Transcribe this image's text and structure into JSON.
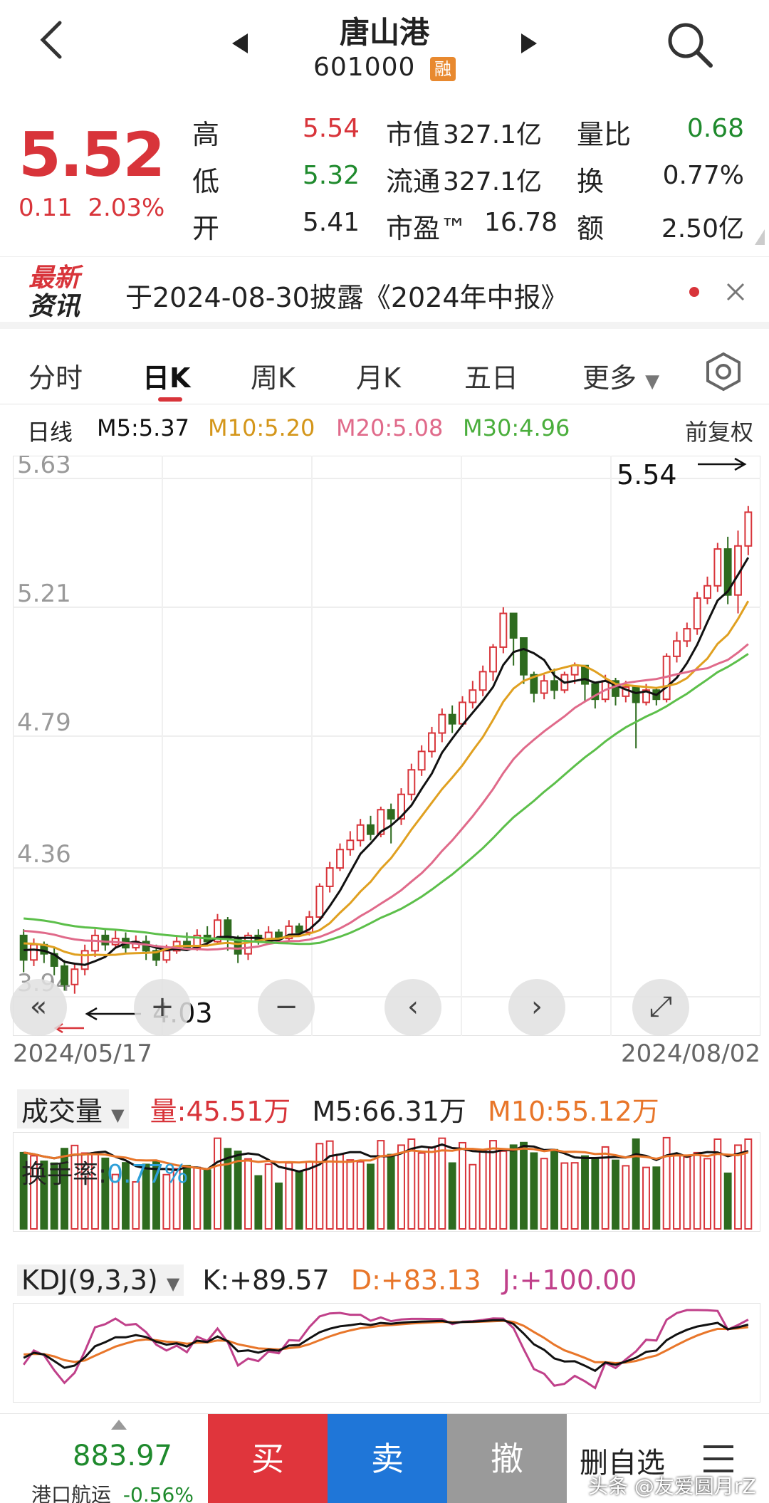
{
  "header": {
    "title": "唐山港",
    "code": "601000",
    "badge": "融"
  },
  "quote": {
    "price": "5.52",
    "change": "0.11",
    "change_pct": "2.03%",
    "high_label": "高",
    "high": "5.54",
    "low_label": "低",
    "low": "5.32",
    "open_label": "开",
    "open": "5.41",
    "mktcap_label": "市值",
    "mktcap": "327.1亿",
    "float_label": "流通",
    "float": "327.1亿",
    "pe_label": "市盈™",
    "pe": "16.78",
    "volratio_label": "量比",
    "volratio": "0.68",
    "turnover_label": "换",
    "turnover": "0.77%",
    "amount_label": "额",
    "amount": "2.50亿"
  },
  "news": {
    "logo_top": "最新",
    "logo_bottom": "资讯",
    "text": "于2024-08-30披露《2024年中报》"
  },
  "tabs": [
    {
      "label": "分时"
    },
    {
      "label": "日K"
    },
    {
      "label": "周K"
    },
    {
      "label": "月K"
    },
    {
      "label": "五日"
    },
    {
      "label": "更多"
    }
  ],
  "ma": {
    "period": "日线",
    "m5": "M5:5.37",
    "m10": "M10:5.20",
    "m20": "M20:5.08",
    "m30": "M30:4.96",
    "adjust": "前复权"
  },
  "colors": {
    "up": "#d8343a",
    "down": "#2e6b1f",
    "m5": "#111111",
    "m10": "#e0a020",
    "m20": "#e06a8a",
    "m30": "#5cbf4a",
    "k": "#111111",
    "d": "#e8762a",
    "j": "#c0408a"
  },
  "chart_data": {
    "type": "candlestick",
    "y_ticks": [
      "5.63",
      "5.21",
      "4.79",
      "4.36",
      "3.94"
    ],
    "ylim": [
      3.94,
      5.63
    ],
    "x_start": "2024/05/17",
    "x_end": "2024/08/02",
    "high_annotation": "5.54",
    "low_annotation": "4.03",
    "candles": [
      [
        4.14,
        4.06,
        4.16,
        4.02
      ],
      [
        4.06,
        4.11,
        4.13,
        4.04
      ],
      [
        4.11,
        4.08,
        4.12,
        4.05
      ],
      [
        4.08,
        4.04,
        4.1,
        4.01
      ],
      [
        4.04,
        3.98,
        4.06,
        3.96
      ],
      [
        3.98,
        4.03,
        4.05,
        3.95
      ],
      [
        4.03,
        4.09,
        4.11,
        4.01
      ],
      [
        4.09,
        4.14,
        4.16,
        4.07
      ],
      [
        4.14,
        4.11,
        4.16,
        4.09
      ],
      [
        4.11,
        4.13,
        4.16,
        4.1
      ],
      [
        4.13,
        4.1,
        4.15,
        4.08
      ],
      [
        4.1,
        4.12,
        4.14,
        4.09
      ],
      [
        4.12,
        4.09,
        4.14,
        4.06
      ],
      [
        4.09,
        4.06,
        4.11,
        4.04
      ],
      [
        4.06,
        4.09,
        4.11,
        4.05
      ],
      [
        4.09,
        4.12,
        4.14,
        4.08
      ],
      [
        4.12,
        4.1,
        4.15,
        4.09
      ],
      [
        4.1,
        4.14,
        4.16,
        4.09
      ],
      [
        4.14,
        4.12,
        4.17,
        4.11
      ],
      [
        4.12,
        4.19,
        4.21,
        4.11
      ],
      [
        4.19,
        4.13,
        4.2,
        4.09
      ],
      [
        4.13,
        4.08,
        4.14,
        4.05
      ],
      [
        4.08,
        4.14,
        4.15,
        4.06
      ],
      [
        4.14,
        4.12,
        4.16,
        4.11
      ],
      [
        4.12,
        4.15,
        4.17,
        4.11
      ],
      [
        4.15,
        4.13,
        4.16,
        4.12
      ],
      [
        4.13,
        4.17,
        4.19,
        4.12
      ],
      [
        4.17,
        4.15,
        4.18,
        4.14
      ],
      [
        4.15,
        4.2,
        4.22,
        4.14
      ],
      [
        4.2,
        4.3,
        4.31,
        4.19
      ],
      [
        4.3,
        4.36,
        4.38,
        4.28
      ],
      [
        4.36,
        4.42,
        4.44,
        4.35
      ],
      [
        4.42,
        4.45,
        4.48,
        4.4
      ],
      [
        4.45,
        4.5,
        4.52,
        4.43
      ],
      [
        4.5,
        4.47,
        4.53,
        4.45
      ],
      [
        4.47,
        4.55,
        4.56,
        4.46
      ],
      [
        4.55,
        4.52,
        4.57,
        4.44
      ],
      [
        4.52,
        4.6,
        4.62,
        4.5
      ],
      [
        4.6,
        4.68,
        4.7,
        4.58
      ],
      [
        4.68,
        4.74,
        4.76,
        4.66
      ],
      [
        4.74,
        4.8,
        4.82,
        4.72
      ],
      [
        4.8,
        4.86,
        4.88,
        4.77
      ],
      [
        4.86,
        4.83,
        4.89,
        4.8
      ],
      [
        4.83,
        4.9,
        4.92,
        4.82
      ],
      [
        4.9,
        4.94,
        4.97,
        4.88
      ],
      [
        4.94,
        5.0,
        5.02,
        4.92
      ],
      [
        5.0,
        5.08,
        5.09,
        4.97
      ],
      [
        5.08,
        5.19,
        5.21,
        5.06
      ],
      [
        5.19,
        5.11,
        5.17,
        5.02
      ],
      [
        5.11,
        4.99,
        5.0,
        4.96
      ],
      [
        4.99,
        4.93,
        5.0,
        4.9
      ],
      [
        4.93,
        4.97,
        4.99,
        4.91
      ],
      [
        4.97,
        4.94,
        5.01,
        4.91
      ],
      [
        4.94,
        4.99,
        5.0,
        4.93
      ],
      [
        4.99,
        5.02,
        5.03,
        4.96
      ],
      [
        5.02,
        4.96,
        5.0,
        4.9
      ],
      [
        4.96,
        4.91,
        4.96,
        4.88
      ],
      [
        4.91,
        4.97,
        4.99,
        4.9
      ],
      [
        4.97,
        4.92,
        4.98,
        4.89
      ],
      [
        4.92,
        4.95,
        4.97,
        4.9
      ],
      [
        4.95,
        4.9,
        4.94,
        4.75
      ],
      [
        4.9,
        4.94,
        4.96,
        4.89
      ],
      [
        4.94,
        4.91,
        4.95,
        4.89
      ],
      [
        4.91,
        5.05,
        5.06,
        4.9
      ],
      [
        5.05,
        5.1,
        5.13,
        5.03
      ],
      [
        5.1,
        5.14,
        5.16,
        5.08
      ],
      [
        5.14,
        5.24,
        5.26,
        5.12
      ],
      [
        5.24,
        5.28,
        5.31,
        5.22
      ],
      [
        5.28,
        5.4,
        5.42,
        5.26
      ],
      [
        5.4,
        5.25,
        5.44,
        5.22
      ],
      [
        5.25,
        5.41,
        5.46,
        5.19
      ],
      [
        5.41,
        5.52,
        5.54,
        5.38
      ]
    ],
    "volume": {
      "label": "成交量",
      "vol": "量:45.51万",
      "m5": "M5:66.31万",
      "m10": "M10:55.12万",
      "turnover_label": "换手率:",
      "turnover": "0.77%"
    },
    "kdj": {
      "label": "KDJ(9,3,3)",
      "k": "K:+89.57",
      "d": "D:+83.13",
      "j": "J:+100.00"
    }
  },
  "bottom": {
    "index_value": "883.97",
    "index_name": "港口航运",
    "index_change": "-0.56%",
    "buy": "买",
    "sell": "卖",
    "cancel": "撤",
    "watch": "删自选",
    "watermark": "头条 @友爱圆月rZ"
  }
}
